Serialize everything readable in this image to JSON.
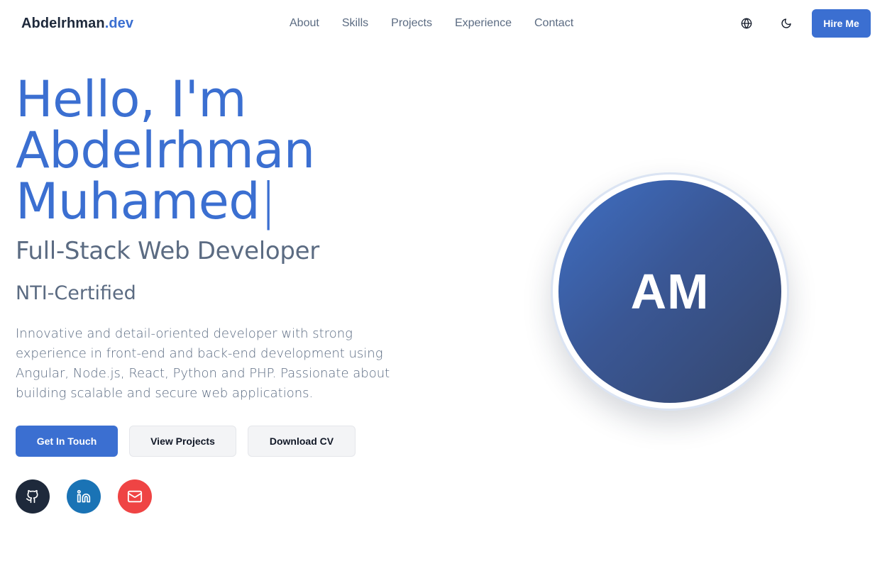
{
  "header": {
    "logo_main": "Abdelrhman",
    "logo_accent": ".dev",
    "nav": [
      {
        "label": "About"
      },
      {
        "label": "Skills"
      },
      {
        "label": "Projects"
      },
      {
        "label": "Experience"
      },
      {
        "label": "Contact"
      }
    ],
    "icons": {
      "language": "globe-icon",
      "theme": "moon-icon"
    },
    "hire_label": "Hire Me"
  },
  "hero": {
    "title_line1": "Hello, I'm",
    "title_line2": "Abdelrhman",
    "title_line3": "Muhamed",
    "cursor": "|",
    "subtitle": "Full-Stack Web Developer",
    "certification": "NTI-Certified",
    "description": "Innovative and detail-oriented developer with strong experience in front-end and back-end development using Angular, Node.js, React, Python and PHP. Passionate about building scalable and secure web applications.",
    "buttons": {
      "contact": "Get In Touch",
      "projects": "View Projects",
      "cv": "Download CV"
    },
    "social": [
      "github-icon",
      "linkedin-icon",
      "mail-icon"
    ],
    "avatar_initials": "AM"
  },
  "colors": {
    "accent": "#3b6fd1",
    "text_muted": "#5b6b82",
    "github": "#1e293b",
    "linkedin": "#1a73b5",
    "mail": "#ef4444"
  }
}
